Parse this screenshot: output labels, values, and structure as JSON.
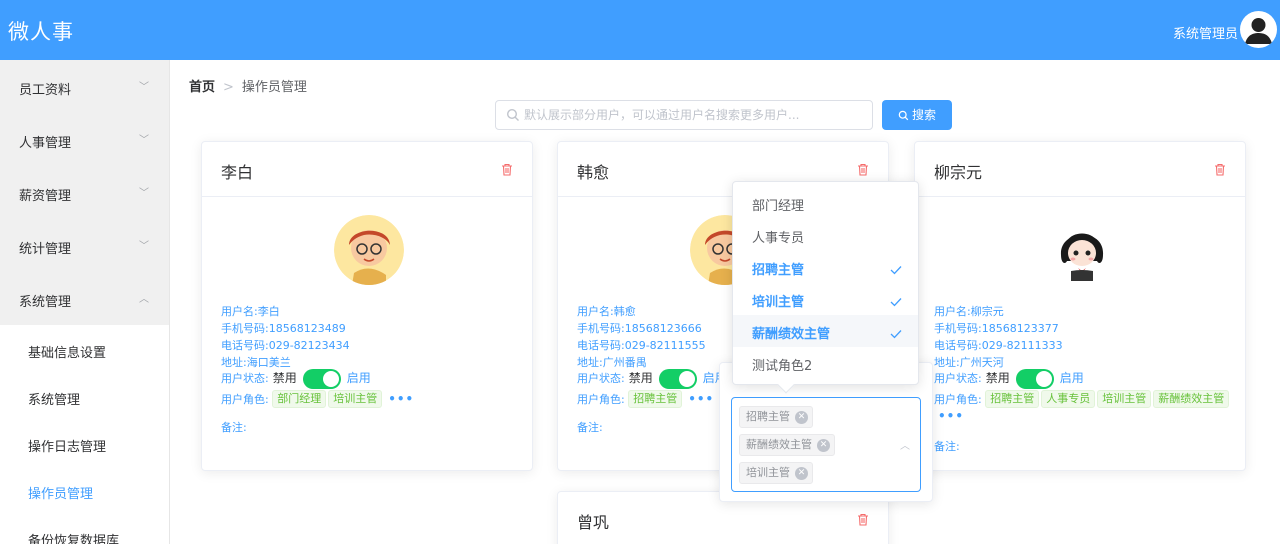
{
  "app": {
    "title": "微人事",
    "admin_name": "系统管理员"
  },
  "sidebar": {
    "groups": [
      {
        "label": "员工资料"
      },
      {
        "label": "人事管理"
      },
      {
        "label": "薪资管理"
      },
      {
        "label": "统计管理"
      },
      {
        "label": "系统管理"
      }
    ],
    "sub_items": [
      {
        "label": "基础信息设置"
      },
      {
        "label": "系统管理"
      },
      {
        "label": "操作日志管理"
      },
      {
        "label": "操作员管理"
      },
      {
        "label": "备份恢复数据库"
      }
    ]
  },
  "breadcrumb": {
    "home": "首页",
    "current": "操作员管理"
  },
  "search": {
    "placeholder": "默认展示部分用户，可以通过用户名搜索更多用户...",
    "button_label": "搜索"
  },
  "labels": {
    "username_prefix": "用户名:",
    "phone_prefix": "手机号码:",
    "tel_prefix": "电话号码:",
    "address_prefix": "地址:",
    "status_label": "用户状态:",
    "status_off": "禁用",
    "status_on": "启用",
    "roles_label": "用户角色:",
    "note_label": "备注:",
    "more": "•••"
  },
  "cards": [
    {
      "name": "李白",
      "username": "李白",
      "phone": "18568123489",
      "tel": "029-82123434",
      "address": "海口美兰",
      "enabled": true,
      "roles": [
        "部门经理",
        "培训主管"
      ]
    },
    {
      "name": "韩愈",
      "username": "韩愈",
      "phone": "18568123666",
      "tel": "029-82111555",
      "address": "广州番禺",
      "enabled": true,
      "roles": [
        "招聘主管"
      ]
    },
    {
      "name": "柳宗元",
      "username": "柳宗元",
      "phone": "18568123377",
      "tel": "029-82111333",
      "address": "广州天河",
      "enabled": true,
      "roles": [
        "招聘主管",
        "人事专员",
        "培训主管",
        "薪酬绩效主管"
      ]
    },
    {
      "name": "曾巩"
    }
  ],
  "role_dropdown": {
    "options": [
      {
        "label": "部门经理",
        "selected": false
      },
      {
        "label": "人事专员",
        "selected": false
      },
      {
        "label": "招聘主管",
        "selected": true
      },
      {
        "label": "培训主管",
        "selected": true
      },
      {
        "label": "薪酬绩效主管",
        "selected": true
      },
      {
        "label": "测试角色2",
        "selected": false
      }
    ],
    "selected_tags": [
      "招聘主管",
      "薪酬绩效主管",
      "培训主管"
    ]
  },
  "colors": {
    "primary": "#409eff",
    "success": "#13ce66",
    "danger": "#f56c6c",
    "tag_green": "#67c23a"
  }
}
